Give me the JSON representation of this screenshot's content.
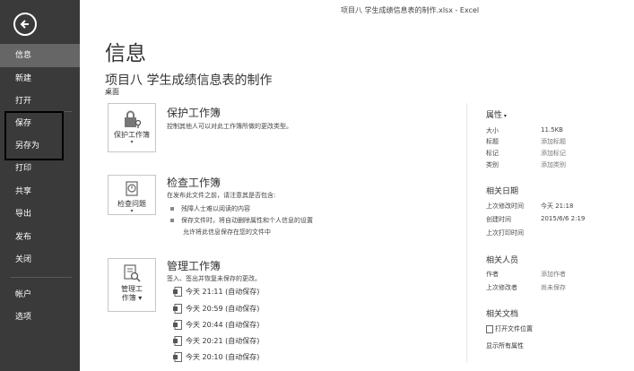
{
  "window": {
    "title": "项目八 学生成绩信息表的制作.xlsx - Excel"
  },
  "sidebar": {
    "items": [
      {
        "label": "信息"
      },
      {
        "label": "新建"
      },
      {
        "label": "打开"
      },
      {
        "label": "保存"
      },
      {
        "label": "另存为"
      },
      {
        "label": "打印"
      },
      {
        "label": "共享"
      },
      {
        "label": "导出"
      },
      {
        "label": "发布"
      },
      {
        "label": "关闭"
      },
      {
        "label": "帐户"
      },
      {
        "label": "选项"
      }
    ]
  },
  "main": {
    "heading": "信息",
    "doc_title": "项目八 学生成绩信息表的制作",
    "doc_location": "桌面",
    "protect": {
      "tile_label": "保护工作簿",
      "title": "保护工作簿",
      "desc": "控制其他人可以对此工作簿所做的更改类型。"
    },
    "inspect": {
      "tile_label": "检查问题",
      "title": "检查工作簿",
      "desc": "在发布此文件之前，请注意其是否包含:",
      "bullets": [
        "残障人士难以阅读的内容",
        "保存文件时，将自动删除属性和个人信息的设置"
      ],
      "note": "允许将此信息保存在您的文件中"
    },
    "manage": {
      "tile_label_1": "管理工",
      "tile_label_2": "作簿",
      "title": "管理工作簿",
      "desc": "签入、签出并恢复未保存的更改。",
      "versions": [
        "今天 21:11 (自动保存)",
        "今天 20:59 (自动保存)",
        "今天 20:44 (自动保存)",
        "今天 20:21 (自动保存)",
        "今天 20:10 (自动保存)"
      ]
    }
  },
  "properties": {
    "heading": "属性",
    "rows": [
      {
        "label": "大小",
        "value": "11.5KB"
      },
      {
        "label": "标题",
        "value": "添加标题"
      },
      {
        "label": "标记",
        "value": "添加标记"
      },
      {
        "label": "类别",
        "value": "添加类别"
      }
    ],
    "dates": {
      "heading": "相关日期",
      "rows": [
        {
          "label": "上次修改时间",
          "value": "今天 21:18"
        },
        {
          "label": "创建时间",
          "value": "2015/6/6 2:19"
        },
        {
          "label": "上次打印时间",
          "value": ""
        }
      ]
    },
    "people": {
      "heading": "相关人员",
      "rows": [
        {
          "label": "作者",
          "value": "添加作者"
        },
        {
          "label": "上次修改者",
          "value": "尚未保存"
        }
      ]
    },
    "docs": {
      "heading": "相关文档",
      "open_location": "打开文件位置",
      "show_all": "显示所有属性"
    }
  }
}
